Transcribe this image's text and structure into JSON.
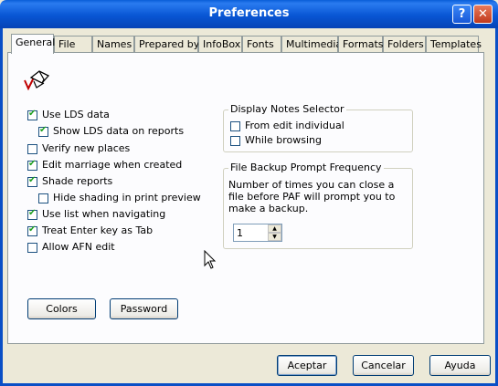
{
  "window": {
    "title": "Preferences",
    "help_button": "?",
    "close_button": "✕"
  },
  "tabs": [
    "General",
    "File",
    "Names",
    "Prepared by",
    "InfoBox",
    "Fonts",
    "Multimedia",
    "Formats",
    "Folders",
    "Templates"
  ],
  "active_tab": "General",
  "options": {
    "use_lds": {
      "label": "Use LDS data",
      "checked": true
    },
    "show_lds_reports": {
      "label": "Show LDS data on reports",
      "checked": true
    },
    "verify_places": {
      "label": "Verify new places",
      "checked": false
    },
    "edit_marriage": {
      "label": "Edit marriage when created",
      "checked": true
    },
    "shade_reports": {
      "label": "Shade reports",
      "checked": true
    },
    "hide_shading": {
      "label": "Hide shading in print preview",
      "checked": false
    },
    "use_list": {
      "label": "Use list when navigating",
      "checked": true
    },
    "enter_tab": {
      "label": "Treat Enter key as Tab",
      "checked": true
    },
    "allow_afn": {
      "label": "Allow AFN edit",
      "checked": false
    }
  },
  "notes_selector": {
    "legend": "Display Notes Selector",
    "from_edit": {
      "label": "From edit individual",
      "checked": false
    },
    "while_browsing": {
      "label": "While browsing",
      "checked": false
    }
  },
  "backup": {
    "legend": "File Backup Prompt Frequency",
    "description": "Number of times you can close a file before PAF will prompt you to make a backup.",
    "value": "1"
  },
  "buttons": {
    "colors": "Colors",
    "password": "Password",
    "ok": "Aceptar",
    "cancel": "Cancelar",
    "help": "Ayuda"
  }
}
